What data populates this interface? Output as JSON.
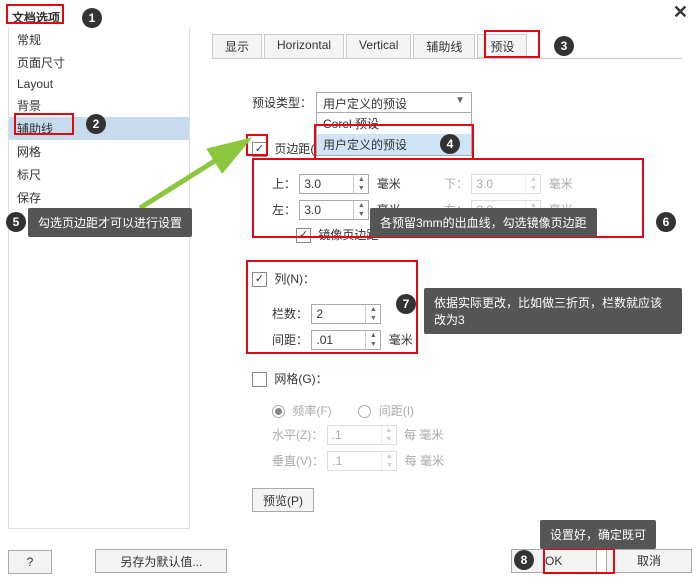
{
  "window": {
    "close": "✕"
  },
  "sidebar": {
    "title": "文档选项",
    "items": [
      "常规",
      "页面尺寸",
      "Layout",
      "背景",
      "辅助线",
      "网格",
      "标尺",
      "保存"
    ],
    "selected_index": 4
  },
  "tabs": {
    "items": [
      "显示",
      "Horizontal",
      "Vertical",
      "辅助线",
      "预设"
    ],
    "selected_index": 4
  },
  "preset_type": {
    "label": "预设类型：",
    "value": "用户定义的预设",
    "options": [
      "Corel 预设",
      "用户定义的预设"
    ],
    "selected_index": 1
  },
  "margins": {
    "group_label_prefix": "页边距(",
    "top_label": "上：",
    "top": "3.0",
    "top_unit": "毫米",
    "bottom_label": "下：",
    "bottom": "3.0",
    "bottom_unit": "毫米",
    "left_label": "左：",
    "left": "3.0",
    "left_unit": "毫米",
    "right_label": "右：",
    "right": "3.0",
    "right_unit": "毫米",
    "mirror": "镜像页边距",
    "checked": true
  },
  "columns": {
    "group_label": "列(N)：",
    "count_label": "栏数：",
    "count": "2",
    "gap_label": "间距：",
    "gap": ".01",
    "gap_unit": "毫米",
    "checked": true
  },
  "grid": {
    "group_label": "网格(G)：",
    "freq_label": "频率(F)",
    "spacing_label": "间距(I)",
    "h_label": "水平(Z)：",
    "h": ".1",
    "h_unit": "每 毫米",
    "v_label": "垂直(V)：",
    "v": ".1",
    "v_unit": "每 毫米",
    "checked": false
  },
  "preview_btn": "预览(P)",
  "bottom": {
    "help": "?",
    "save_default": "另存为默认值...",
    "ok": "OK",
    "cancel": "取消"
  },
  "annotations": {
    "b1": "1",
    "b2": "2",
    "b3": "3",
    "b4": "4",
    "b5": "5",
    "b6": "6",
    "b7": "7",
    "b8": "8",
    "tip5": "勾选页边距才可以进行设置",
    "tip6": "各预留3mm的出血线，勾选镜像页边距",
    "tip7": "依据实际更改，比如做三折页，栏数就应该改为3",
    "tip8": "设置好，确定既可"
  },
  "colors": {
    "red": "#e30613",
    "accent_sel": "#c7dbee",
    "tip_bg": "#555555"
  }
}
